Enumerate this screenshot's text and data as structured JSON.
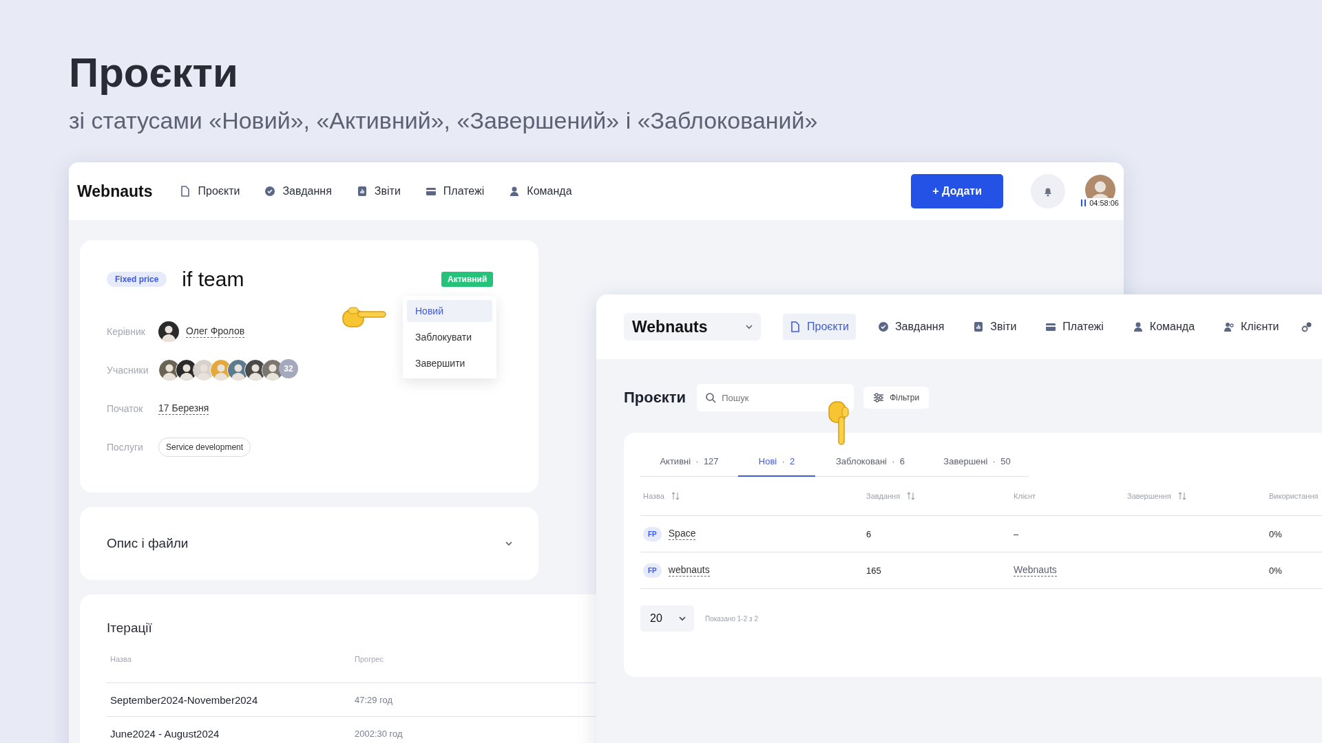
{
  "heading": {
    "title": "Проєкти",
    "subtitle": "зі статусами «Новий», «Активний», «Завершений» і «Заблокований»"
  },
  "main_window": {
    "nav": {
      "logo": "Webnauts",
      "items": [
        {
          "label": "Проєкти"
        },
        {
          "label": "Завдання"
        },
        {
          "label": "Звіти"
        },
        {
          "label": "Платежі"
        },
        {
          "label": "Команда"
        }
      ],
      "add_button": "+ Додати",
      "timer": "04:58:06"
    },
    "project_card": {
      "type_badge": "Fixed price",
      "title": "if team",
      "status": "Активний",
      "status_menu": [
        {
          "label": "Новий",
          "selected": true
        },
        {
          "label": "Заблокувати",
          "selected": false
        },
        {
          "label": "Завершити",
          "selected": false
        }
      ],
      "fields": [
        {
          "kind": "person",
          "label": "Керівник",
          "value": "Олег Фролов"
        },
        {
          "kind": "avatars",
          "label": "Учасники",
          "count": "32"
        },
        {
          "kind": "date",
          "label": "Початок",
          "value": "17 Березня"
        },
        {
          "kind": "tag",
          "label": "Послуги",
          "value": "Service development"
        }
      ]
    },
    "description_panel": {
      "title": "Опис і файли",
      "expanded": false
    },
    "iterations": {
      "title": "Ітерації",
      "columns": [
        "Назва",
        "Прогрес"
      ],
      "rows": [
        {
          "name": "September2024-November2024",
          "progress": "47:29 год"
        },
        {
          "name": "June2024 - August2024",
          "progress": "2002:30 год"
        }
      ]
    }
  },
  "projects_window": {
    "nav": {
      "logo": "Webnauts",
      "items": [
        {
          "label": "Проєкти",
          "selected": true
        },
        {
          "label": "Завдання",
          "selected": false
        },
        {
          "label": "Звіти",
          "selected": false
        },
        {
          "label": "Платежі",
          "selected": false
        },
        {
          "label": "Команда",
          "selected": false
        },
        {
          "label": "Клієнти",
          "selected": false
        }
      ]
    },
    "title": "Проєкти",
    "search": {
      "placeholder": "Пошук"
    },
    "filters_button": "Фільтри",
    "tabs": [
      {
        "label": "Активні  ·  127",
        "selected": false
      },
      {
        "label": "Нові  ·  2",
        "selected": true
      },
      {
        "label": "Заблоковані  ·  6",
        "selected": false
      },
      {
        "label": "Завершені  ·  50",
        "selected": false
      }
    ],
    "columns": [
      {
        "label": "Назва",
        "sortable": true
      },
      {
        "label": "Завдання",
        "sortable": true
      },
      {
        "label": "Клієнт",
        "sortable": false
      },
      {
        "label": "Завершення",
        "sortable": true
      },
      {
        "label": "Використання"
      }
    ],
    "rows": [
      {
        "badge": "FP",
        "name": "Space",
        "tasks": "6",
        "client": "–",
        "client_link": false,
        "usage": "0%"
      },
      {
        "badge": "FP",
        "name": "webnauts",
        "tasks": "165",
        "client": "Webnauts",
        "client_link": true,
        "usage": "0%"
      }
    ],
    "page_size": "20",
    "summary": "Показано 1-2 з 2"
  }
}
